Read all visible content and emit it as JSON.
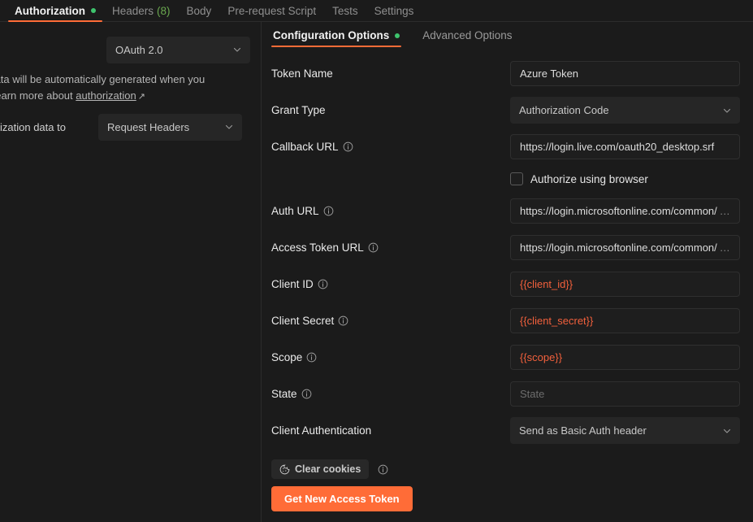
{
  "tabs": [
    {
      "label": "Authorization",
      "active": true,
      "dot": true
    },
    {
      "label": "Headers",
      "count": "(8)",
      "active": false
    },
    {
      "label": "Body",
      "active": false
    },
    {
      "label": "Pre-request Script",
      "active": false
    },
    {
      "label": "Tests",
      "active": false
    },
    {
      "label": "Settings",
      "active": false
    }
  ],
  "left_panel": {
    "auth_type_value": "OAuth 2.0",
    "description_part1": "zation data will be automatically generated when you",
    "description_part2": "quest. Learn more about",
    "description_link": "authorization",
    "add_to_label": "ization data to",
    "add_to_value": "Request Headers"
  },
  "right_panel": {
    "subtabs": [
      {
        "label": "Configuration Options",
        "active": true,
        "dot": true
      },
      {
        "label": "Advanced Options",
        "active": false
      }
    ],
    "fields": [
      {
        "label": "Token Name",
        "info": false,
        "type": "text",
        "value": "Azure Token",
        "style": "normal",
        "truncated": false
      },
      {
        "label": "Grant Type",
        "info": false,
        "type": "select",
        "value": "Authorization Code"
      },
      {
        "label": "Callback URL",
        "info": true,
        "type": "text",
        "value": "https://login.live.com/oauth20_desktop.srf",
        "style": "normal",
        "truncated": false
      },
      {
        "label": "",
        "info": false,
        "type": "checkbox",
        "value": "Authorize using browser",
        "checked": false
      },
      {
        "label": "Auth URL",
        "info": true,
        "type": "text",
        "value": "https://login.microsoftonline.com/common/",
        "style": "normal",
        "truncated": true
      },
      {
        "label": "Access Token URL",
        "info": true,
        "type": "text",
        "value": "https://login.microsoftonline.com/common/",
        "style": "normal",
        "truncated": true
      },
      {
        "label": "Client ID",
        "info": true,
        "type": "text",
        "value": "{{client_id}}",
        "style": "var",
        "truncated": false
      },
      {
        "label": "Client Secret",
        "info": true,
        "type": "text",
        "value": "{{client_secret}}",
        "style": "var",
        "truncated": false
      },
      {
        "label": "Scope",
        "info": true,
        "type": "text",
        "value": "{{scope}}",
        "style": "var",
        "truncated": false
      },
      {
        "label": "State",
        "info": true,
        "type": "text",
        "value": "State",
        "style": "placeholder",
        "truncated": false
      },
      {
        "label": "Client Authentication",
        "info": false,
        "type": "select",
        "value": "Send as Basic Auth header"
      }
    ],
    "clear_cookies_label": "Clear cookies",
    "get_token_label": "Get New Access Token",
    "ellipsis": "…"
  },
  "colors": {
    "accent": "#ff6c37",
    "status_dot": "#3ec46d",
    "variable": "#f2603c",
    "background": "#1b1b1b"
  }
}
